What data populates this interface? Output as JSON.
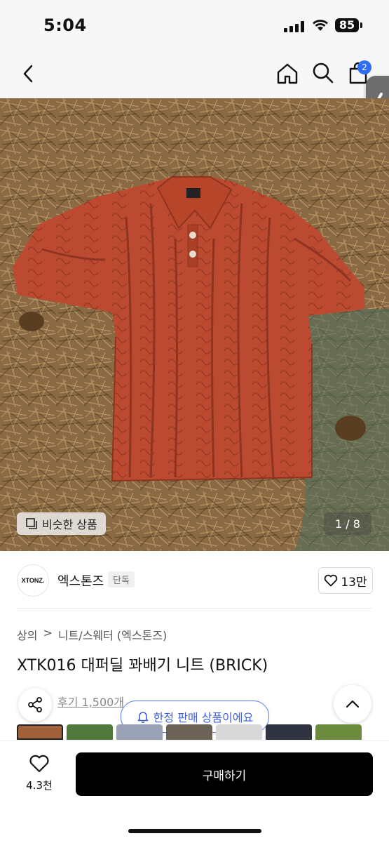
{
  "status_bar": {
    "time": "5:04",
    "battery": "85"
  },
  "nav": {
    "back_icon": "chevron-left-icon",
    "home_icon": "home-icon",
    "search_icon": "search-icon",
    "cart_icon": "shopping-bag-icon",
    "cart_badge": "2"
  },
  "gallery": {
    "similar_label": "비슷한 상품",
    "page_indicator": "1 / 8"
  },
  "brand": {
    "logo_text": "XTONZ.",
    "name": "엑스톤즈",
    "tag": "단독",
    "like_count": "13만"
  },
  "product": {
    "breadcrumb": [
      "상의",
      "니트/스웨터 (엑스톤즈)"
    ],
    "title": "XTK016 대퍼딜 꽈배기 니트 (BRICK)",
    "review_link": "후기 1,500개",
    "limited_notice": "한정 판매 상품이에요"
  },
  "bottom_bar": {
    "like_count": "4.3천",
    "buy_label": "구매하기"
  },
  "colors": {
    "accent": "#3d5fe0",
    "badge": "#2f6df6",
    "buy_button": "#000000",
    "shirt": "#b8482f"
  }
}
